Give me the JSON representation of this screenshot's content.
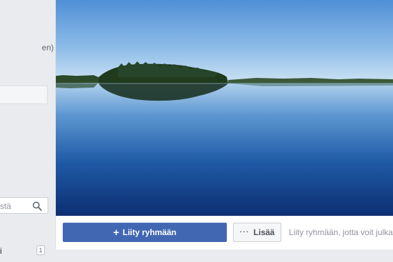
{
  "sidebar": {
    "privacy_text": "en)",
    "search_placeholder": "stä",
    "item_label": "i",
    "item_count": "1"
  },
  "cover": {
    "alt_subject": "lake-island-photo"
  },
  "actions": {
    "join_plus": "+",
    "join_label": "Liity ryhmään",
    "more_dots": "···",
    "more_label": "Lisää",
    "hint_text": "Liity ryhmään, jotta voit julkaista"
  }
}
